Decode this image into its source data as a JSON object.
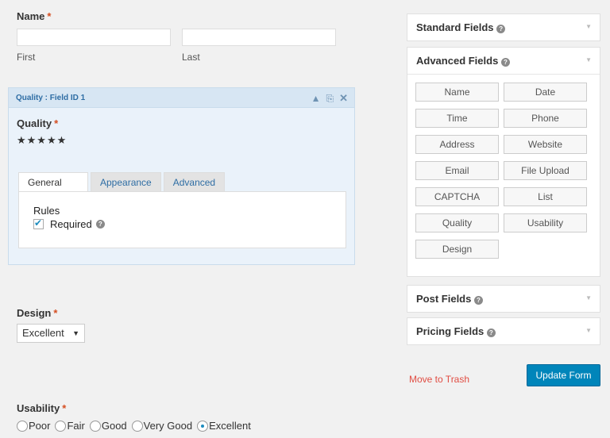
{
  "name_field": {
    "label": "Name",
    "required_mark": "*",
    "first_label": "First",
    "last_label": "Last",
    "first_value": "",
    "last_value": ""
  },
  "quality_panel": {
    "title": "Quality : Field ID 1",
    "field_label": "Quality",
    "required_mark": "*",
    "stars": "★★★★★",
    "tabs": [
      "General",
      "Appearance",
      "Advanced"
    ],
    "rules_label": "Rules",
    "required_label": "Required",
    "required_checked": true
  },
  "design_field": {
    "label": "Design",
    "required_mark": "*",
    "selected": "Excellent"
  },
  "usability_field": {
    "label": "Usability",
    "required_mark": "*",
    "options": [
      "Poor",
      "Fair",
      "Good",
      "Very Good",
      "Excellent"
    ],
    "selected_index": 4
  },
  "sidebar": {
    "standard_title": "Standard Fields",
    "advanced_title": "Advanced Fields",
    "advanced_buttons": [
      "Name",
      "Date",
      "Time",
      "Phone",
      "Address",
      "Website",
      "Email",
      "File Upload",
      "CAPTCHA",
      "List",
      "Quality",
      "Usability",
      "Design"
    ],
    "post_title": "Post Fields",
    "pricing_title": "Pricing Fields"
  },
  "actions": {
    "trash_label": "Move to Trash",
    "update_label": "Update Form"
  },
  "colors": {
    "accent": "#0085ba",
    "danger": "#e14d43",
    "required": "#d54e21"
  }
}
